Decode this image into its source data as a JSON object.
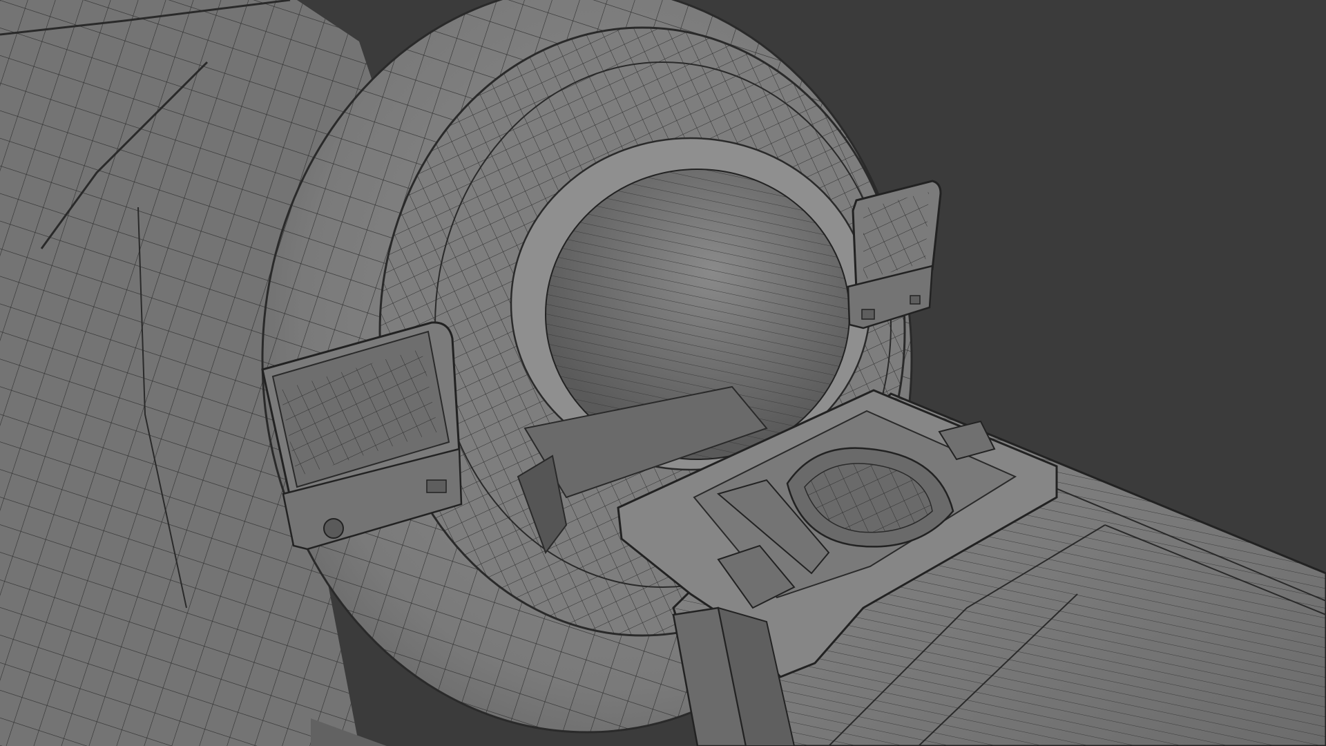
{
  "scene": {
    "background_color": "#3b3b3b",
    "mesh_fill_color": "#7a7a7a",
    "mesh_light_color": "#8e8e8e",
    "mesh_dark_color": "#4f4f4f",
    "wire_color": "#2a2a2a",
    "objects": [
      "mri-scanner-gantry",
      "gantry-bore",
      "left-control-panel",
      "right-control-panel",
      "patient-table",
      "head-coil-cradle"
    ]
  }
}
